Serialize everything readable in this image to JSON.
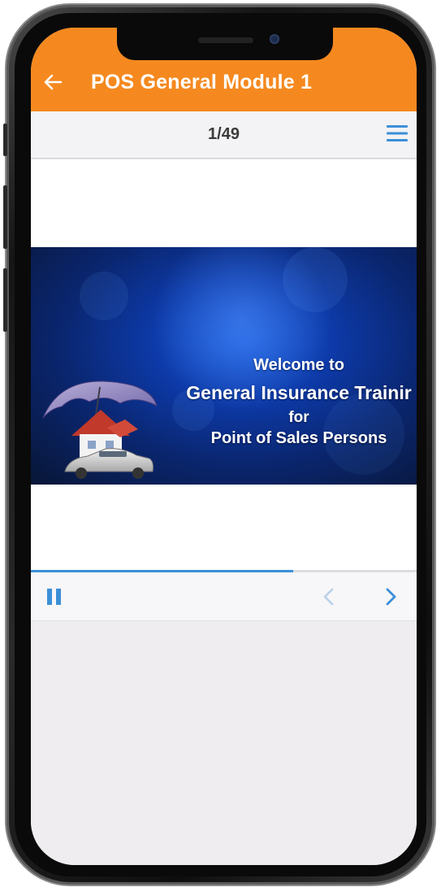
{
  "header": {
    "title": "POS General Module 1",
    "background": "#f5891f"
  },
  "page_bar": {
    "counter": "1/49"
  },
  "slide": {
    "line1": "Welcome to",
    "line2": "General Insurance Trainir",
    "line3": "for",
    "line4": "Point of Sales Persons"
  },
  "progress": {
    "fraction": 0.68,
    "color": "#3b8fd8"
  },
  "controls": {
    "pause_icon": "pause-icon",
    "prev_icon": "chevron-left-icon",
    "next_icon": "chevron-right-icon"
  },
  "icons": {
    "back": "arrow-left-icon",
    "menu": "hamburger-menu-icon"
  }
}
